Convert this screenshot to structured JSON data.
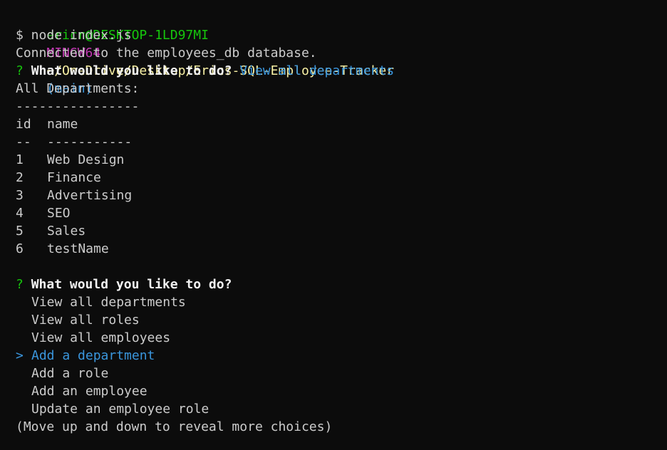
{
  "prompt_line": {
    "user_host": "ericr@DESKTOP-1LD97MI",
    "shell": "MINGW64",
    "path": "~/OneDrive/Desktop/Erics-SQL-Employee-Tracker",
    "branch": "(main)"
  },
  "command": "$ node index.js",
  "connected_message": "Connected to the employees_db database.",
  "question1": {
    "mark": "?",
    "text": "What would you like to do?",
    "answer": "View all departments"
  },
  "table": {
    "title": "All Departments:",
    "title_rule": "----------------",
    "headers": [
      "id",
      "name"
    ],
    "rules": [
      "--",
      "-----------"
    ],
    "rows": [
      {
        "id": "1",
        "name": "Web Design"
      },
      {
        "id": "2",
        "name": "Finance"
      },
      {
        "id": "3",
        "name": "Advertising"
      },
      {
        "id": "4",
        "name": "SEO"
      },
      {
        "id": "5",
        "name": "Sales"
      },
      {
        "id": "6",
        "name": "testName"
      }
    ]
  },
  "question2": {
    "mark": "?",
    "text": "What would you like to do?",
    "pointer": ">",
    "options": [
      "View all departments",
      "View all roles",
      "View all employees",
      "Add a department",
      "Add a role",
      "Add an employee",
      "Update an employee role"
    ],
    "selected_index": 3,
    "hint": "(Move up and down to reveal more choices)"
  },
  "colors": {
    "background": "#0c0c0c",
    "text": "#cccccc",
    "green": "#16c60c",
    "magenta": "#c239b3",
    "yellow": "#f9f1a5",
    "cyan": "#3a96dd"
  }
}
